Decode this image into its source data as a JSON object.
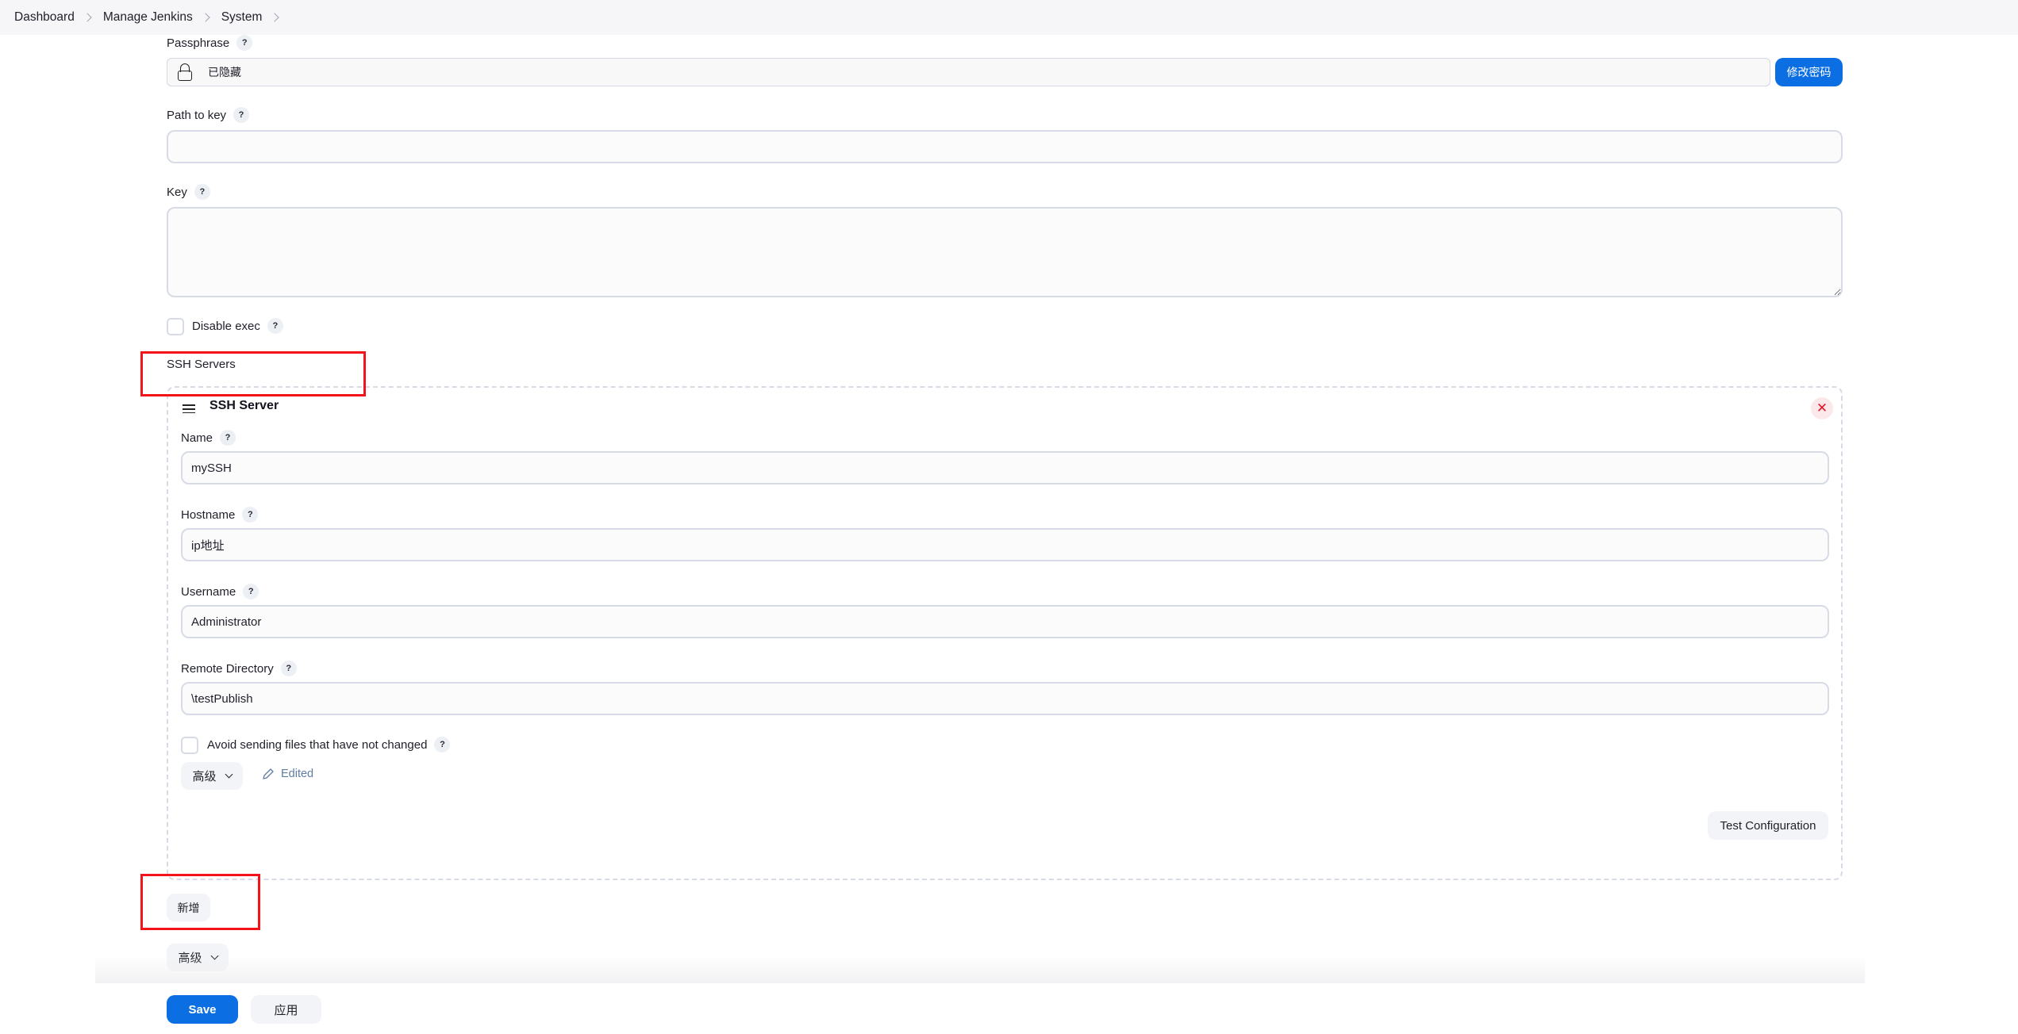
{
  "breadcrumb": [
    "Dashboard",
    "Manage Jenkins",
    "System"
  ],
  "passphrase": {
    "label": "Passphrase",
    "help": "?",
    "value": "已隐藏",
    "icon": "lock-icon",
    "change_button": "修改密码"
  },
  "path_to_key": {
    "label": "Path to key",
    "help": "?",
    "value": ""
  },
  "key": {
    "label": "Key",
    "help": "?",
    "value": ""
  },
  "disable_exec": {
    "label": "Disable exec",
    "help": "?",
    "checked": false
  },
  "ssh_servers": {
    "section_label": "SSH Servers",
    "server": {
      "title": "SSH Server",
      "drag_icon": "drag-handle-icon",
      "close_icon": "close-icon",
      "fields": [
        {
          "label": "Name",
          "help": "?",
          "value": "mySSH"
        },
        {
          "label": "Hostname",
          "help": "?",
          "value": "ip地址"
        },
        {
          "label": "Username",
          "help": "?",
          "value": "Administrator"
        },
        {
          "label": "Remote Directory",
          "help": "?",
          "value": "\\testPublish"
        }
      ],
      "avoid_sending": {
        "label": "Avoid sending files that have not changed",
        "help": "?",
        "checked": false
      },
      "advanced_button": "高级",
      "edited_label": "Edited",
      "test_button": "Test Configuration"
    },
    "add_button": "新增"
  },
  "advanced_button": "高级",
  "footer": {
    "save": "Save",
    "apply": "应用"
  },
  "colors": {
    "primary": "#0b6fe3",
    "annotation": "#f5131a",
    "close": "#e3162b"
  }
}
